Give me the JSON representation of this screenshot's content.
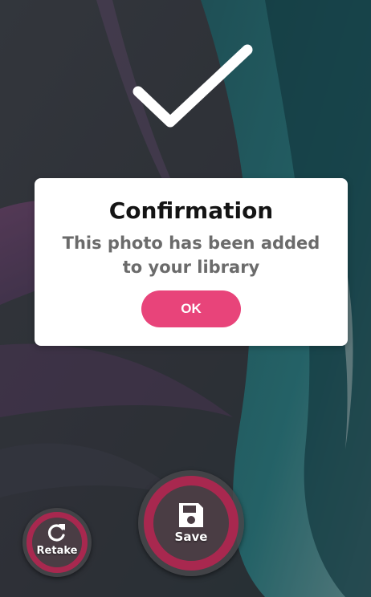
{
  "dialog": {
    "title": "Confirmation",
    "message": "This photo has been added to your library",
    "ok_label": "OK"
  },
  "actions": {
    "retake_label": "Retake",
    "save_label": "Save"
  },
  "icons": {
    "success": "checkmark-icon",
    "retake": "refresh-icon",
    "save": "floppy-disk-icon"
  },
  "colors": {
    "accent": "#e8447a",
    "button_ring": "#a8284f",
    "dialog_bg": "#ffffff",
    "title_text": "#141414",
    "message_text": "#6b6b6b"
  }
}
